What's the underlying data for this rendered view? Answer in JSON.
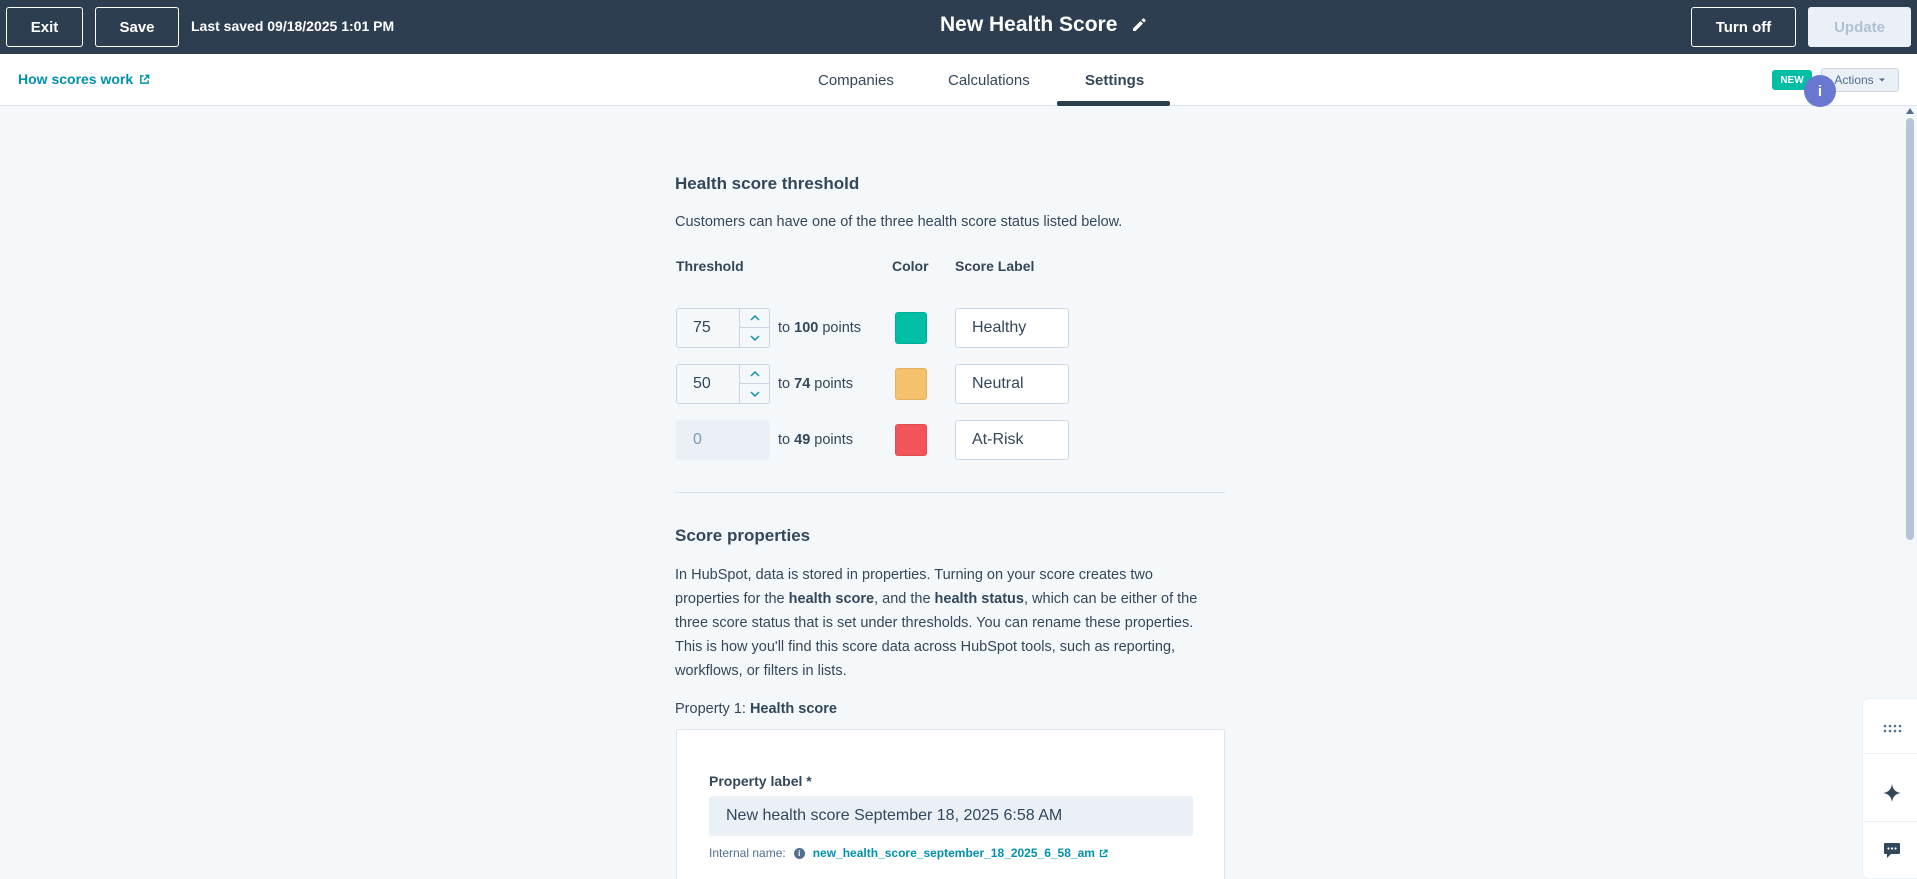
{
  "topbar": {
    "exit_label": "Exit",
    "save_label": "Save",
    "last_saved": "Last saved 09/18/2025 1:01 PM",
    "title": "New Health Score",
    "turn_off_label": "Turn off",
    "update_label": "Update"
  },
  "subbar": {
    "how_scores_link": "How scores work",
    "tabs": [
      {
        "label": "Companies",
        "active": false
      },
      {
        "label": "Calculations",
        "active": false
      },
      {
        "label": "Settings",
        "active": true
      }
    ],
    "new_badge": "NEW",
    "actions_label": "Actions",
    "info_badge": "i"
  },
  "threshold": {
    "title": "Health score threshold",
    "description": "Customers can have one of the three health score status listed below.",
    "col_threshold": "Threshold",
    "col_color": "Color",
    "col_label": "Score Label",
    "to_word": "to",
    "points_word": "points",
    "rows": [
      {
        "min": "75",
        "max": "100",
        "color": "#00bda5",
        "label": "Healthy",
        "editable": true
      },
      {
        "min": "50",
        "max": "74",
        "color": "#f5c26b",
        "label": "Neutral",
        "editable": true
      },
      {
        "min": "0",
        "max": "49",
        "color": "#f2545b",
        "label": "At-Risk",
        "editable": false
      }
    ]
  },
  "score_properties": {
    "title": "Score properties",
    "desc_1": "In HubSpot, data is stored in properties. Turning on your score creates two properties for the ",
    "desc_bold_1": "health score",
    "desc_2": ", and the ",
    "desc_bold_2": "health status",
    "desc_3": ", which can be either of the three score status that is set under thresholds. You can rename these properties. This is how you'll find this score data across HubSpot tools, such as reporting, workflows, or filters in lists.",
    "property1_prefix": "Property 1: ",
    "property1_name": "Health score",
    "property_label_title": "Property label *",
    "property_label_value": "New health score September 18, 2025 6:58 AM",
    "internal_name_label": "Internal name:",
    "internal_name_value": "new_health_score_september_18_2025_6_58_am"
  },
  "colors": {
    "topbar": "#2d3e50",
    "link": "#0091ae",
    "badge": "#00bda5",
    "info": "#6a78d1"
  }
}
